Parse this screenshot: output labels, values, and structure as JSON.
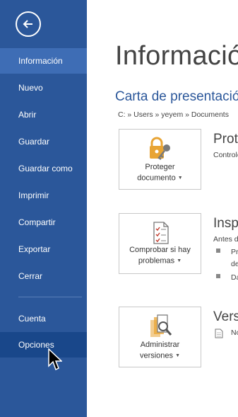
{
  "sidebar": {
    "items": [
      {
        "label": "Información"
      },
      {
        "label": "Nuevo"
      },
      {
        "label": "Abrir"
      },
      {
        "label": "Guardar"
      },
      {
        "label": "Guardar como"
      },
      {
        "label": "Imprimir"
      },
      {
        "label": "Compartir"
      },
      {
        "label": "Exportar"
      },
      {
        "label": "Cerrar"
      },
      {
        "label": "Cuenta"
      },
      {
        "label": "Opciones"
      }
    ],
    "selected_item": "Información",
    "hovered_item": "Opciones"
  },
  "main": {
    "title": "Información",
    "document_title": "Carta de presentación",
    "path": "C: » Users » yeyem » Documents",
    "sections": {
      "protect": {
        "button_line1": "Proteger",
        "button_line2": "documento",
        "heading": "Proteger documento",
        "text": "Controle qué tipos de cambios pueden realizar"
      },
      "inspect": {
        "button_line1": "Comprobar si hay",
        "button_line2": "problemas",
        "heading": "Inspeccionar documento",
        "text": "Antes de publicar este archivo, tenga en cuenta que contiene:",
        "bullet1_line1": "Propiedades del documento y",
        "bullet1_line2": "de su autor",
        "bullet2": "Datos XML personalizados"
      },
      "versions": {
        "button_line1": "Administrar",
        "button_line2": "versiones",
        "heading": "Versiones",
        "text": "No hay versiones anteriores de este archivo."
      }
    }
  },
  "icons": {
    "back": "back-arrow-icon",
    "protect": "lock-key-icon",
    "inspect": "checklist-icon",
    "versions": "document-search-icon",
    "dropdown": "caret-down-icon",
    "cursor": "mouse-pointer-icon"
  },
  "colors": {
    "sidebar_bg": "#2b579a",
    "selected_bg": "#3e6db5",
    "accent": "#2b579a",
    "lock": "#e8a434"
  }
}
